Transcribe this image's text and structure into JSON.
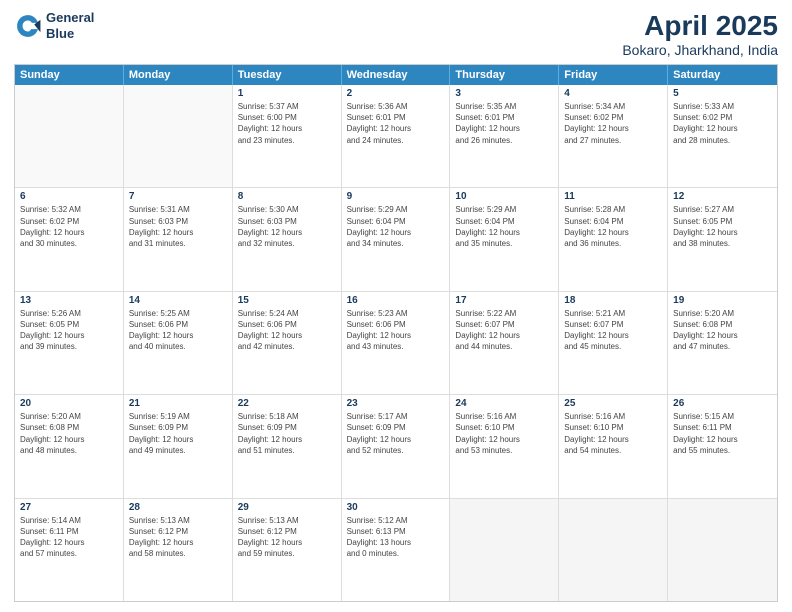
{
  "header": {
    "logo_line1": "General",
    "logo_line2": "Blue",
    "title": "April 2025",
    "subtitle": "Bokaro, Jharkhand, India"
  },
  "weekdays": [
    "Sunday",
    "Monday",
    "Tuesday",
    "Wednesday",
    "Thursday",
    "Friday",
    "Saturday"
  ],
  "weeks": [
    [
      {
        "day": "",
        "info": ""
      },
      {
        "day": "",
        "info": ""
      },
      {
        "day": "1",
        "info": "Sunrise: 5:37 AM\nSunset: 6:00 PM\nDaylight: 12 hours\nand 23 minutes."
      },
      {
        "day": "2",
        "info": "Sunrise: 5:36 AM\nSunset: 6:01 PM\nDaylight: 12 hours\nand 24 minutes."
      },
      {
        "day": "3",
        "info": "Sunrise: 5:35 AM\nSunset: 6:01 PM\nDaylight: 12 hours\nand 26 minutes."
      },
      {
        "day": "4",
        "info": "Sunrise: 5:34 AM\nSunset: 6:02 PM\nDaylight: 12 hours\nand 27 minutes."
      },
      {
        "day": "5",
        "info": "Sunrise: 5:33 AM\nSunset: 6:02 PM\nDaylight: 12 hours\nand 28 minutes."
      }
    ],
    [
      {
        "day": "6",
        "info": "Sunrise: 5:32 AM\nSunset: 6:02 PM\nDaylight: 12 hours\nand 30 minutes."
      },
      {
        "day": "7",
        "info": "Sunrise: 5:31 AM\nSunset: 6:03 PM\nDaylight: 12 hours\nand 31 minutes."
      },
      {
        "day": "8",
        "info": "Sunrise: 5:30 AM\nSunset: 6:03 PM\nDaylight: 12 hours\nand 32 minutes."
      },
      {
        "day": "9",
        "info": "Sunrise: 5:29 AM\nSunset: 6:04 PM\nDaylight: 12 hours\nand 34 minutes."
      },
      {
        "day": "10",
        "info": "Sunrise: 5:29 AM\nSunset: 6:04 PM\nDaylight: 12 hours\nand 35 minutes."
      },
      {
        "day": "11",
        "info": "Sunrise: 5:28 AM\nSunset: 6:04 PM\nDaylight: 12 hours\nand 36 minutes."
      },
      {
        "day": "12",
        "info": "Sunrise: 5:27 AM\nSunset: 6:05 PM\nDaylight: 12 hours\nand 38 minutes."
      }
    ],
    [
      {
        "day": "13",
        "info": "Sunrise: 5:26 AM\nSunset: 6:05 PM\nDaylight: 12 hours\nand 39 minutes."
      },
      {
        "day": "14",
        "info": "Sunrise: 5:25 AM\nSunset: 6:06 PM\nDaylight: 12 hours\nand 40 minutes."
      },
      {
        "day": "15",
        "info": "Sunrise: 5:24 AM\nSunset: 6:06 PM\nDaylight: 12 hours\nand 42 minutes."
      },
      {
        "day": "16",
        "info": "Sunrise: 5:23 AM\nSunset: 6:06 PM\nDaylight: 12 hours\nand 43 minutes."
      },
      {
        "day": "17",
        "info": "Sunrise: 5:22 AM\nSunset: 6:07 PM\nDaylight: 12 hours\nand 44 minutes."
      },
      {
        "day": "18",
        "info": "Sunrise: 5:21 AM\nSunset: 6:07 PM\nDaylight: 12 hours\nand 45 minutes."
      },
      {
        "day": "19",
        "info": "Sunrise: 5:20 AM\nSunset: 6:08 PM\nDaylight: 12 hours\nand 47 minutes."
      }
    ],
    [
      {
        "day": "20",
        "info": "Sunrise: 5:20 AM\nSunset: 6:08 PM\nDaylight: 12 hours\nand 48 minutes."
      },
      {
        "day": "21",
        "info": "Sunrise: 5:19 AM\nSunset: 6:09 PM\nDaylight: 12 hours\nand 49 minutes."
      },
      {
        "day": "22",
        "info": "Sunrise: 5:18 AM\nSunset: 6:09 PM\nDaylight: 12 hours\nand 51 minutes."
      },
      {
        "day": "23",
        "info": "Sunrise: 5:17 AM\nSunset: 6:09 PM\nDaylight: 12 hours\nand 52 minutes."
      },
      {
        "day": "24",
        "info": "Sunrise: 5:16 AM\nSunset: 6:10 PM\nDaylight: 12 hours\nand 53 minutes."
      },
      {
        "day": "25",
        "info": "Sunrise: 5:16 AM\nSunset: 6:10 PM\nDaylight: 12 hours\nand 54 minutes."
      },
      {
        "day": "26",
        "info": "Sunrise: 5:15 AM\nSunset: 6:11 PM\nDaylight: 12 hours\nand 55 minutes."
      }
    ],
    [
      {
        "day": "27",
        "info": "Sunrise: 5:14 AM\nSunset: 6:11 PM\nDaylight: 12 hours\nand 57 minutes."
      },
      {
        "day": "28",
        "info": "Sunrise: 5:13 AM\nSunset: 6:12 PM\nDaylight: 12 hours\nand 58 minutes."
      },
      {
        "day": "29",
        "info": "Sunrise: 5:13 AM\nSunset: 6:12 PM\nDaylight: 12 hours\nand 59 minutes."
      },
      {
        "day": "30",
        "info": "Sunrise: 5:12 AM\nSunset: 6:13 PM\nDaylight: 13 hours\nand 0 minutes."
      },
      {
        "day": "",
        "info": ""
      },
      {
        "day": "",
        "info": ""
      },
      {
        "day": "",
        "info": ""
      }
    ]
  ]
}
